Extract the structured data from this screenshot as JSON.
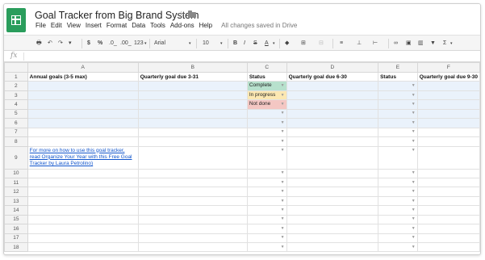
{
  "app": {
    "title": "Goal Tracker from Big Brand System",
    "save_status": "All changes saved in Drive"
  },
  "menu": [
    "File",
    "Edit",
    "View",
    "Insert",
    "Format",
    "Data",
    "Tools",
    "Add-ons",
    "Help"
  ],
  "toolbar": {
    "currency": "$",
    "percent": "%",
    "decrease_decimals": ".0_",
    "increase_decimals": ".00_",
    "more_formats": "123",
    "font": "Arial",
    "font_size": "10",
    "bold": "B",
    "italic": "I",
    "strikethrough": "S",
    "text_color": "A",
    "sum": "Σ"
  },
  "formula_bar": {
    "label": "fx",
    "value": ""
  },
  "columns": [
    "A",
    "B",
    "C",
    "D",
    "E",
    "F"
  ],
  "rows": [
    {
      "n": "1",
      "cells": [
        "Annual goals (3-5 max)",
        "Quarterly goal due 3-31",
        "Status",
        "Quarterly goal due 6-30",
        "Status",
        "Quarterly goal due 9-30"
      ]
    },
    {
      "n": "2",
      "cells": [
        "",
        "",
        "Complete",
        "",
        "",
        ""
      ]
    },
    {
      "n": "3",
      "cells": [
        "",
        "",
        "In progress",
        "",
        "",
        ""
      ]
    },
    {
      "n": "4",
      "cells": [
        "",
        "",
        "Not done",
        "",
        "",
        ""
      ]
    },
    {
      "n": "5",
      "cells": [
        "",
        "",
        "",
        "",
        "",
        ""
      ]
    },
    {
      "n": "6",
      "cells": [
        "",
        "",
        "",
        "",
        "",
        ""
      ]
    },
    {
      "n": "7",
      "cells": [
        "",
        "",
        "",
        "",
        "",
        ""
      ]
    },
    {
      "n": "8",
      "cells": [
        "",
        "",
        "",
        "",
        "",
        ""
      ]
    },
    {
      "n": "9",
      "cells": [
        "For more on how to use this goal tracker, read Organize Your Year with this Free Goal Tracker by Laura Petrolino)",
        "",
        "",
        "",
        "",
        ""
      ]
    },
    {
      "n": "10",
      "cells": [
        "",
        "",
        "",
        "",
        "",
        ""
      ]
    },
    {
      "n": "11",
      "cells": [
        "",
        "",
        "",
        "",
        "",
        ""
      ]
    },
    {
      "n": "12",
      "cells": [
        "",
        "",
        "",
        "",
        "",
        ""
      ]
    },
    {
      "n": "13",
      "cells": [
        "",
        "",
        "",
        "",
        "",
        ""
      ]
    },
    {
      "n": "14",
      "cells": [
        "",
        "",
        "",
        "",
        "",
        ""
      ]
    },
    {
      "n": "15",
      "cells": [
        "",
        "",
        "",
        "",
        "",
        ""
      ]
    },
    {
      "n": "16",
      "cells": [
        "",
        "",
        "",
        "",
        "",
        ""
      ]
    },
    {
      "n": "17",
      "cells": [
        "",
        "",
        "",
        "",
        "",
        ""
      ]
    },
    {
      "n": "18",
      "cells": [
        "",
        "",
        "",
        "",
        "",
        ""
      ]
    }
  ],
  "colors": {
    "brand": "#2a9d5c",
    "complete": "#b7e1cd",
    "in_progress": "#fce8b2",
    "not_done": "#f4c7c3",
    "link": "#1155cc"
  }
}
